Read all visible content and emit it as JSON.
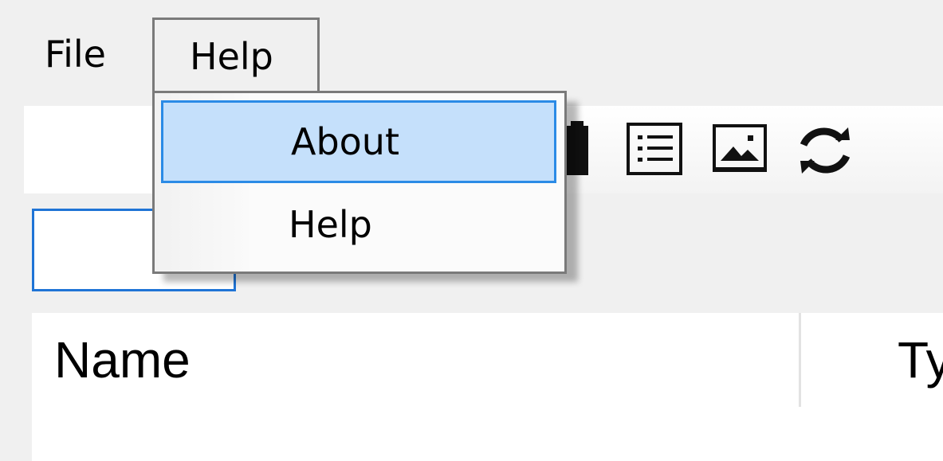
{
  "menubar": {
    "file_label": "File",
    "help_label": "Help"
  },
  "help_menu": {
    "items": [
      {
        "label": "About",
        "highlighted": true
      },
      {
        "label": "Help",
        "highlighted": false
      }
    ]
  },
  "toolbar": {
    "icons": [
      "clipboard-icon",
      "list-details-icon",
      "image-icon",
      "refresh-icon"
    ]
  },
  "search": {
    "value": ""
  },
  "table": {
    "columns": [
      "Name",
      "Ty"
    ]
  },
  "colors": {
    "highlight_fill": "#c5e0fb",
    "highlight_border": "#2b8be6",
    "focus_border": "#1f74d6"
  }
}
